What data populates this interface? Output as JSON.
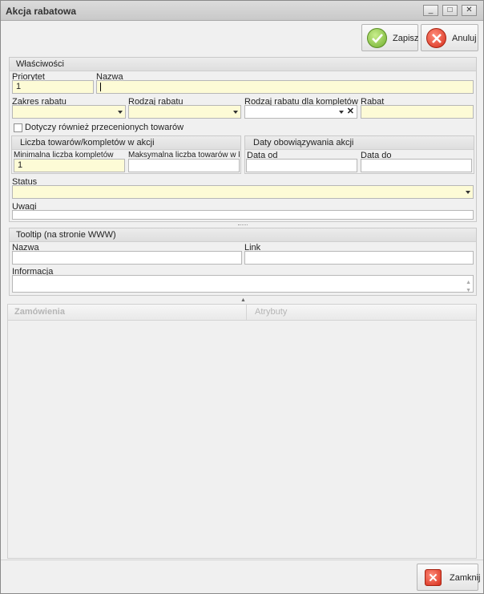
{
  "window": {
    "title": "Akcja rabatowa",
    "minimize": "_",
    "maximize": "□",
    "close": "✕"
  },
  "toolbar": {
    "save_label": "Zapisz",
    "cancel_label": "Anuluj"
  },
  "properties": {
    "header": "Właściwości",
    "priority_label": "Priorytet",
    "priority_value": "1",
    "name_label": "Nazwa",
    "name_value": "",
    "discount_scope_label": "Zakres rabatu",
    "discount_type_label": "Rodzaj rabatu",
    "set_discount_type_label": "Rodzaj rabatu dla kompletów",
    "discount_label": "Rabat",
    "include_discounted_label": "Dotyczy również przecenionych towarów",
    "count_group": {
      "header": "Liczba towarów/kompletów w akcji",
      "min_label": "Minimalna liczba kompletów",
      "min_value": "1",
      "max_label": "Maksymalna liczba towarów w komp"
    },
    "dates_group": {
      "header": "Daty obowiązywania akcji",
      "from_label": "Data od",
      "to_label": "Data do"
    },
    "status_label": "Status",
    "notes_label": "Uwagi"
  },
  "tooltip": {
    "header": "Tooltip (na stronie WWW)",
    "name_label": "Nazwa",
    "link_label": "Link",
    "info_label": "Informacja"
  },
  "tabs": [
    {
      "label": "Zamówienia"
    },
    {
      "label": "Atrybuty"
    }
  ],
  "footer": {
    "close_label": "Zamknij"
  }
}
